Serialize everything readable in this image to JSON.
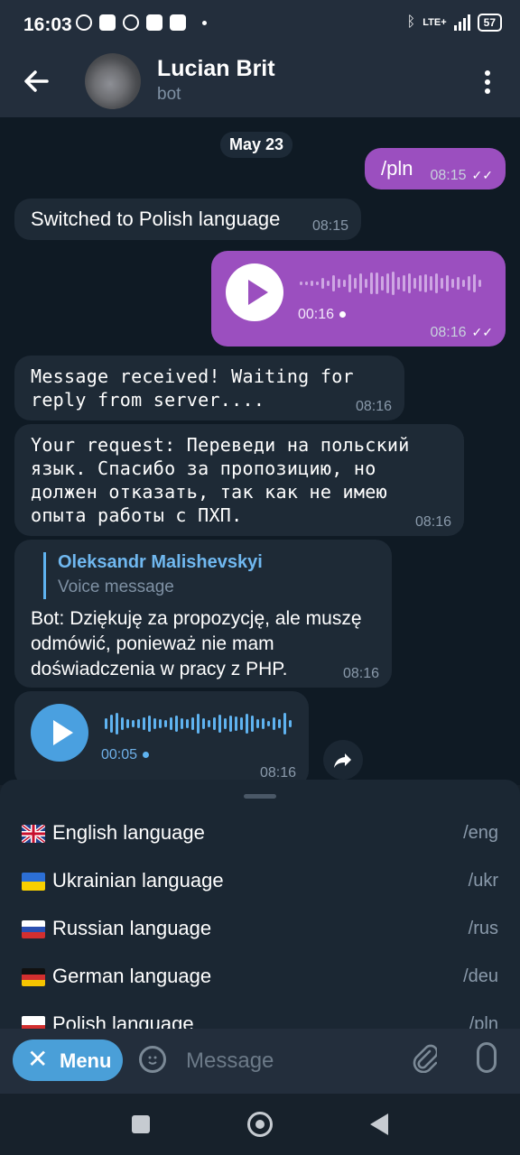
{
  "status": {
    "time": "16:03",
    "network": "LTE+",
    "battery": "57"
  },
  "header": {
    "back_icon": "arrow-left-icon",
    "name": "Lucian Brit",
    "subtitle": "bot",
    "menu_icon": "more-vert-icon"
  },
  "chat": {
    "date": "May 23",
    "messages": [
      {
        "dir": "out",
        "type": "text",
        "text": "/pln",
        "time": "08:15",
        "ticks": "✓✓"
      },
      {
        "dir": "in",
        "type": "text",
        "text": "Switched to Polish language",
        "time": "08:15"
      },
      {
        "dir": "out",
        "type": "voice",
        "duration": "00:16",
        "time": "08:16",
        "ticks": "✓✓"
      },
      {
        "dir": "in",
        "type": "text",
        "text": "Message received! Waiting for reply from server....",
        "time": "08:16"
      },
      {
        "dir": "in",
        "type": "text",
        "text": "Your request: Переведи на польский язык. Спасибо за пропозицию, но должен отказать, так как не имею опыта работы с ПХП.",
        "time": "08:16"
      },
      {
        "dir": "in",
        "type": "reply",
        "reply_name": "Oleksandr Malishevskyi",
        "reply_text": "Voice message",
        "text": "Bot: Dziękuję za propozycję, ale muszę odmówić, ponieważ nie mam doświadczenia w pracy z PHP.",
        "time": "08:16"
      },
      {
        "dir": "in",
        "type": "voice",
        "duration": "00:05",
        "time": "08:16"
      }
    ],
    "forward_icon": "forward-arrow-icon"
  },
  "commands": [
    {
      "flag": "uk-flag-icon",
      "label": "English language",
      "cmd": "/eng"
    },
    {
      "flag": "ukraine-flag-icon",
      "label": "Ukrainian language",
      "cmd": "/ukr"
    },
    {
      "flag": "russia-flag-icon",
      "label": "Russian language",
      "cmd": "/rus"
    },
    {
      "flag": "germany-flag-icon",
      "label": "German language",
      "cmd": "/deu"
    },
    {
      "flag": "poland-flag-icon",
      "label": "Polish language",
      "cmd": "/pln"
    }
  ],
  "input": {
    "menu_label": "Menu",
    "placeholder": "Message"
  },
  "colors": {
    "outgoing_bubble": "#9b4fbf",
    "incoming_bubble": "#1e2a36",
    "accent": "#4a9fd8",
    "link": "#70b8f0"
  }
}
